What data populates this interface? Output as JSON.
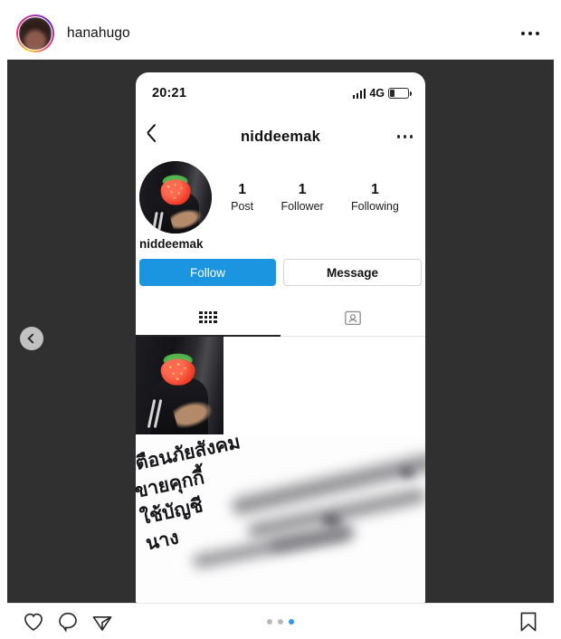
{
  "post": {
    "username": "hanahugo",
    "avatar_icon": "user-avatar-photo",
    "menu_icon": "more-options-icon"
  },
  "media": {
    "carousel": {
      "prev_icon": "chevron-left-icon",
      "dot_count": 3,
      "active_index": 2,
      "active_color": "#2f97e8",
      "inactive_color": "#b9b9b9"
    },
    "phone_screenshot": {
      "statusbar": {
        "time": "20:21",
        "signal_icon": "signal-bars-icon",
        "network": "4G",
        "battery_icon": "battery-low-icon",
        "battery_percent": 28
      },
      "nav": {
        "back_icon": "chevron-left-icon",
        "title": "niddeemak",
        "menu_icon": "more-options-icon"
      },
      "profile": {
        "avatar_icon": "profile-photo-strawberry-emoji",
        "display_name": "niddeemak",
        "stats": [
          {
            "value": "1",
            "label": "Post"
          },
          {
            "value": "1",
            "label": "Follower"
          },
          {
            "value": "1",
            "label": "Following"
          }
        ]
      },
      "buttons": {
        "follow_label": "Follow",
        "follow_color": "#1b95e0",
        "message_label": "Message"
      },
      "tabs": [
        {
          "icon": "grid-icon",
          "active": true
        },
        {
          "icon": "tagged-person-icon",
          "active": false
        }
      ],
      "grid": {
        "thumbnails": [
          {
            "icon": "post-thumbnail-strawberry-emoji"
          }
        ]
      },
      "flyer": {
        "lines": [
          "เตือนภัยสังคม",
          "ขายคุกกี้",
          "ใช้บัญชี",
          "นาง"
        ],
        "redacted": true
      }
    }
  },
  "actions": {
    "like_icon": "heart-icon",
    "comment_icon": "comment-bubble-icon",
    "share_icon": "share-paper-plane-icon",
    "save_icon": "bookmark-icon"
  }
}
